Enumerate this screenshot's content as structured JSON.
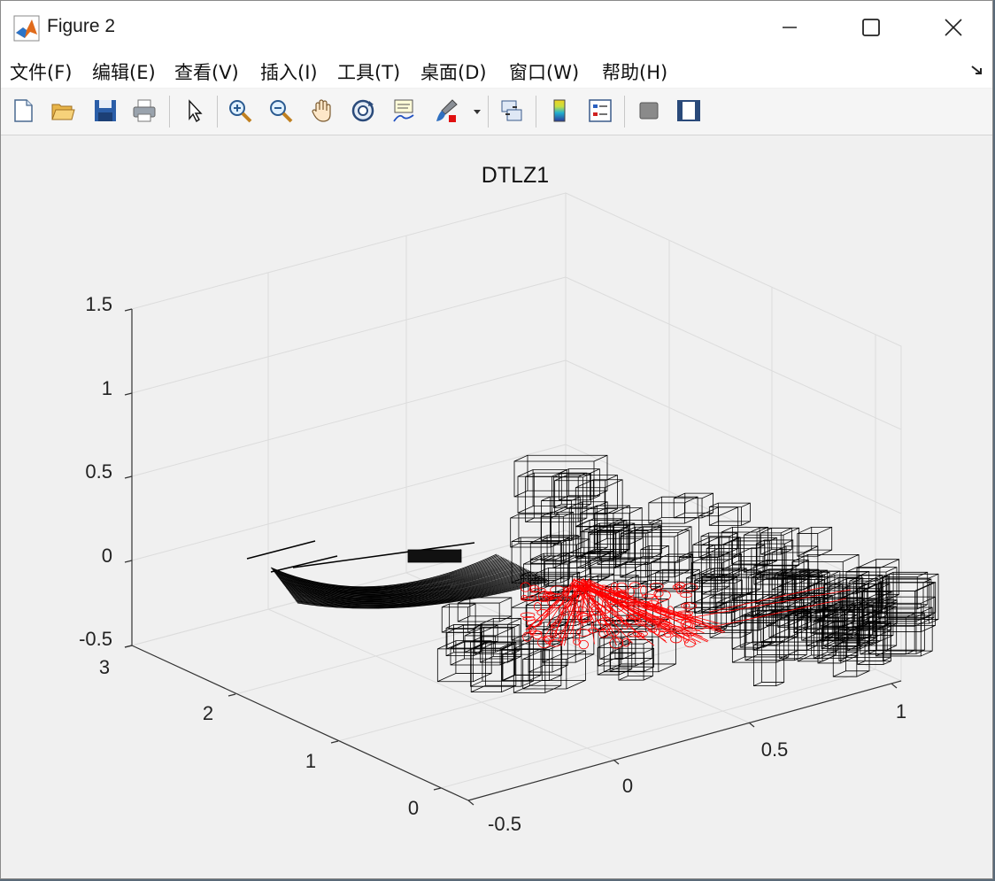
{
  "window": {
    "title": "Figure 2"
  },
  "menu": [
    "文件(F)",
    "编辑(E)",
    "查看(V)",
    "插入(I)",
    "工具(T)",
    "桌面(D)",
    "窗口(W)",
    "帮助(H)"
  ],
  "toolbar_icons": [
    "new-file-icon",
    "open-folder-icon",
    "save-icon",
    "print-icon",
    "pointer-icon",
    "zoom-in-icon",
    "zoom-out-icon",
    "pan-hand-icon",
    "rotate-3d-icon",
    "data-cursor-icon",
    "brush-icon",
    "link-plot-icon",
    "colorbar-icon",
    "legend-icon",
    "hide-plot-tools-icon",
    "show-plot-tools-icon"
  ],
  "colors": {
    "series_boxes": "#000000",
    "series_pareto": "#ff0000",
    "grid": "#dcdcdc",
    "plot_bg": "#f0f0f0"
  },
  "chart_data": {
    "type": "scatter",
    "title": "DTLZ1",
    "xlabel": "",
    "ylabel": "",
    "zlabel": "",
    "x_ticks": [
      "-0.5",
      "0",
      "0.5",
      "1"
    ],
    "y_ticks": [
      "0",
      "1",
      "2",
      "3"
    ],
    "z_ticks": [
      "-0.5",
      "0",
      "0.5",
      "1",
      "1.5"
    ],
    "xlim": [
      -0.5,
      1
    ],
    "ylim": [
      0,
      3
    ],
    "zlim": [
      -0.5,
      1.5
    ],
    "grid": true,
    "view": "3d"
  }
}
